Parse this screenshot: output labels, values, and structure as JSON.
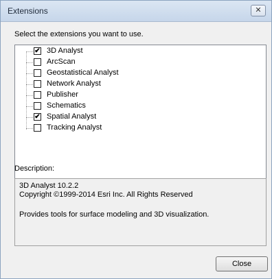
{
  "window": {
    "title": "Extensions",
    "close_glyph": "✕"
  },
  "instruction": "Select the extensions you want to use.",
  "extensions": [
    {
      "label": "3D Analyst",
      "checked": true
    },
    {
      "label": "ArcScan",
      "checked": false
    },
    {
      "label": "Geostatistical Analyst",
      "checked": false
    },
    {
      "label": "Network Analyst",
      "checked": false
    },
    {
      "label": "Publisher",
      "checked": false
    },
    {
      "label": "Schematics",
      "checked": false
    },
    {
      "label": "Spatial Analyst",
      "checked": true
    },
    {
      "label": "Tracking Analyst",
      "checked": false
    }
  ],
  "description": {
    "label": "Description:",
    "line1": "3D Analyst 10.2.2",
    "line2": "Copyright ©1999-2014 Esri Inc. All Rights Reserved",
    "line3": "Provides tools for surface modeling and 3D visualization."
  },
  "buttons": {
    "close_label": "Close"
  }
}
